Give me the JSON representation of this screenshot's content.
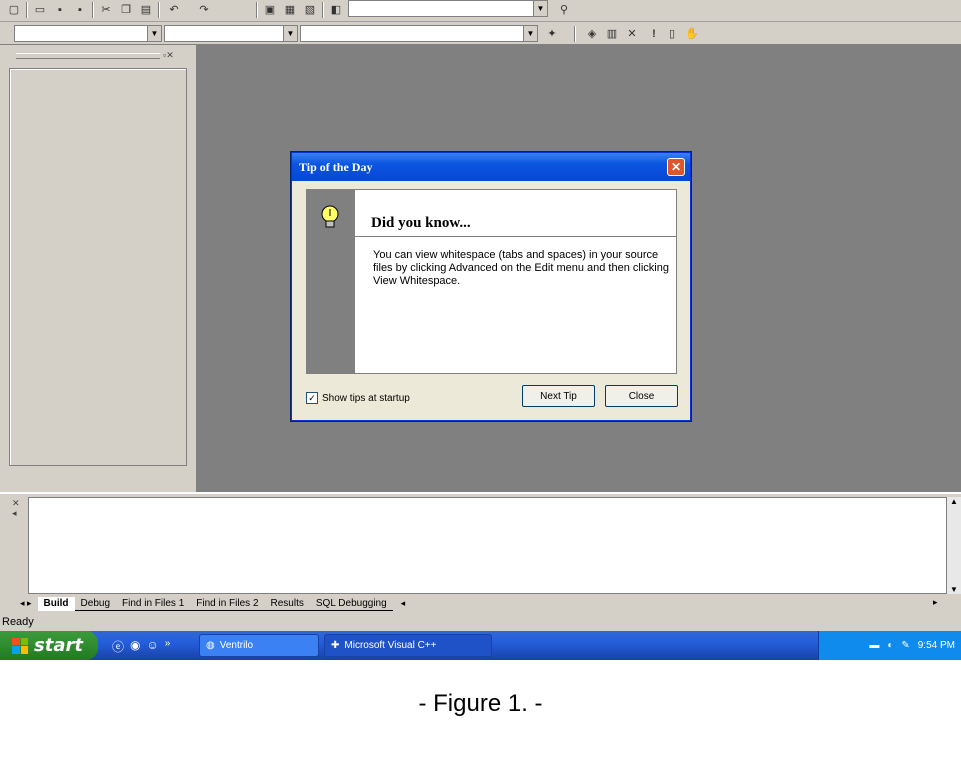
{
  "window": {
    "toolbar_icons": [
      "new-icon",
      "open-icon",
      "save-icon",
      "save-all-icon",
      "cut-icon",
      "copy-icon",
      "paste-icon",
      "undo-icon",
      "redo-icon",
      "workspace-icon",
      "output-icon",
      "window-list-icon",
      "find-in-files-icon",
      "find-icon"
    ],
    "build_toolbar_icons": [
      "wizard-icon",
      "compile-icon",
      "build-icon",
      "stop-build-icon",
      "execute-icon",
      "breakpoint-icon",
      "go-icon"
    ]
  },
  "dialog": {
    "title": "Tip of the Day",
    "heading": "Did you know...",
    "tip_text": "You can view whitespace (tabs and spaces) in your source files by clicking Advanced on the Edit menu and then clicking View Whitespace.",
    "show_tips_label": "Show tips at startup",
    "show_tips_checked": true,
    "next_tip_label": "Next Tip",
    "close_label": "Close"
  },
  "output": {
    "tabs": [
      "Build",
      "Debug",
      "Find in Files 1",
      "Find in Files 2",
      "Results",
      "SQL Debugging"
    ],
    "active_tab": "Build"
  },
  "status": {
    "text": "Ready"
  },
  "taskbar": {
    "start_label": "start",
    "tasks": [
      {
        "label": "Ventrilo",
        "icon": "ventrilo-icon"
      },
      {
        "label": "Microsoft Visual C++",
        "icon": "visual-cpp-icon"
      }
    ],
    "clock": "9:54 PM",
    "quicklaunch": [
      "ie-icon",
      "firefox-icon",
      "aim-icon"
    ],
    "overflow": "»"
  },
  "caption": "- Figure 1. -"
}
